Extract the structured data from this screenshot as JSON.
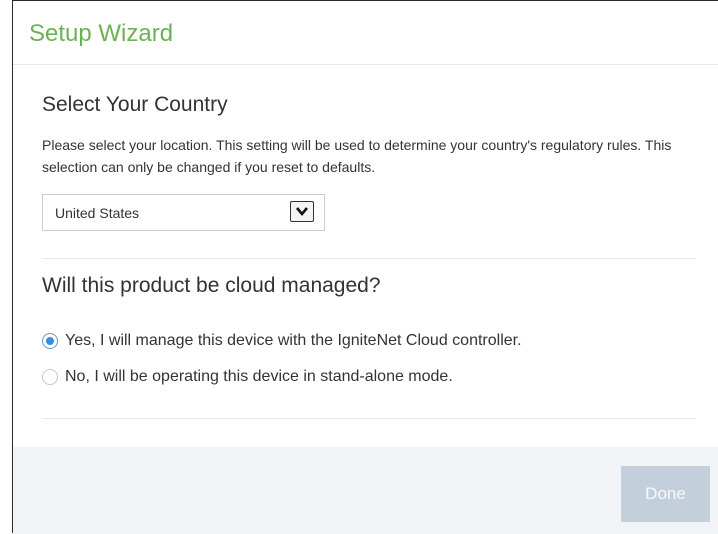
{
  "dialog": {
    "title": "Setup Wizard"
  },
  "country_section": {
    "title": "Select Your Country",
    "description": "Please select your location. This setting will be used to determine your country's regulatory rules. This selection can only be changed if you reset to defaults.",
    "selected_country": "United States"
  },
  "cloud_section": {
    "question": "Will this product be cloud managed?",
    "options": [
      {
        "label": "Yes, I will manage this device with the IgniteNet Cloud controller.",
        "checked": true
      },
      {
        "label": "No, I will be operating this device in stand-alone mode.",
        "checked": false
      }
    ]
  },
  "footer": {
    "done_label": "Done"
  },
  "colors": {
    "title_green": "#6cb253",
    "radio_blue": "#3c8ddc",
    "done_disabled_bg": "#c3d0dc",
    "footer_bg": "#f2f3f7"
  },
  "icons": {
    "select_arrow": "chevron-down-icon"
  }
}
